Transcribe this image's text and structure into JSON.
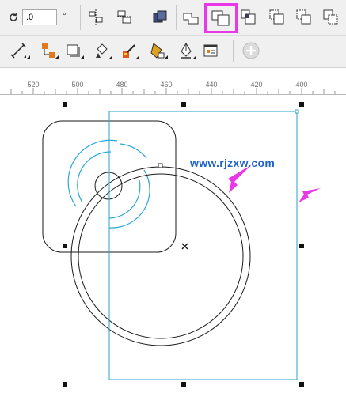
{
  "property_bar": {
    "rotation_icon": "rotate-icon",
    "rotation_value": ".0",
    "degree_symbol": "°"
  },
  "toolbar_row1": [
    "align-distribute-icon",
    "transform-order-icon",
    "combine-shapes-icon",
    "weld-icon",
    "trim-icon",
    "intersect-icon",
    "simplify-icon",
    "front-minus-back-icon",
    "back-minus-front-icon",
    "create-boundary-icon"
  ],
  "toolbar_row2": [
    "dimension-tool-icon",
    "connector-tool-icon",
    "drop-shadow-icon",
    "fill-tool-icon",
    "eyedropper-icon",
    "interactive-fill-icon",
    "pen-tool-icon",
    "object-properties-icon",
    "add-tool-icon"
  ],
  "highlight_color": "#e838e8",
  "ruler": {
    "labels": [
      "520",
      "500",
      "480",
      "460",
      "440",
      "420",
      "400"
    ]
  },
  "canvas": {
    "watermark": "www.rjzxw.com",
    "selection_color": "#2aa3c8",
    "arc_color": "#2aa8dc"
  }
}
